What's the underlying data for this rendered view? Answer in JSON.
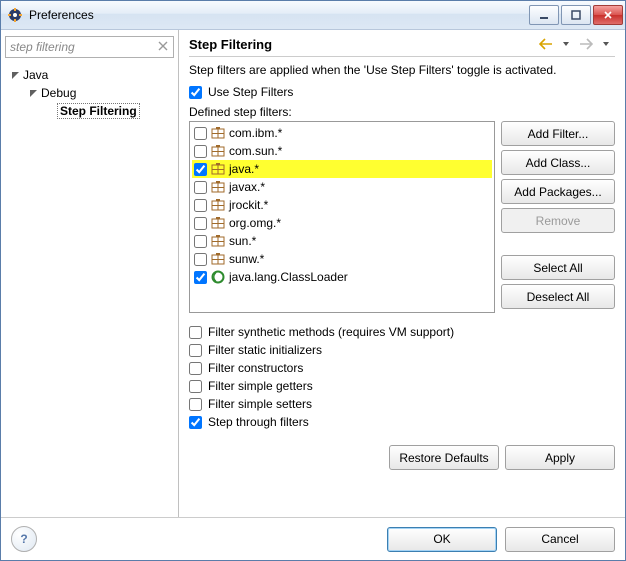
{
  "window": {
    "title": "Preferences"
  },
  "search": {
    "value": "step filtering"
  },
  "tree": {
    "root": "Java",
    "child": "Debug",
    "leaf": "Step Filtering"
  },
  "page": {
    "title": "Step Filtering",
    "description": "Step filters are applied when the 'Use Step Filters' toggle is activated.",
    "use_step_filters": {
      "label": "Use Step Filters",
      "checked": true
    },
    "defined_label": "Defined step filters:",
    "filters": [
      {
        "label": "com.ibm.*",
        "checked": false,
        "icon": "package",
        "highlight": false
      },
      {
        "label": "com.sun.*",
        "checked": false,
        "icon": "package",
        "highlight": false
      },
      {
        "label": "java.*",
        "checked": true,
        "icon": "package",
        "highlight": true
      },
      {
        "label": "javax.*",
        "checked": false,
        "icon": "package",
        "highlight": false
      },
      {
        "label": "jrockit.*",
        "checked": false,
        "icon": "package",
        "highlight": false
      },
      {
        "label": "org.omg.*",
        "checked": false,
        "icon": "package",
        "highlight": false
      },
      {
        "label": "sun.*",
        "checked": false,
        "icon": "package",
        "highlight": false
      },
      {
        "label": "sunw.*",
        "checked": false,
        "icon": "package",
        "highlight": false
      },
      {
        "label": "java.lang.ClassLoader",
        "checked": true,
        "icon": "class",
        "highlight": false
      }
    ],
    "buttons": {
      "add_filter": "Add Filter...",
      "add_class": "Add Class...",
      "add_packages": "Add Packages...",
      "remove": "Remove",
      "select_all": "Select All",
      "deselect_all": "Deselect All"
    },
    "options": [
      {
        "label": "Filter synthetic methods (requires VM support)",
        "checked": false
      },
      {
        "label": "Filter static initializers",
        "checked": false
      },
      {
        "label": "Filter constructors",
        "checked": false
      },
      {
        "label": "Filter simple getters",
        "checked": false
      },
      {
        "label": "Filter simple setters",
        "checked": false
      },
      {
        "label": "Step through filters",
        "checked": true
      }
    ],
    "restore_defaults": "Restore Defaults",
    "apply": "Apply"
  },
  "footer": {
    "ok": "OK",
    "cancel": "Cancel"
  }
}
